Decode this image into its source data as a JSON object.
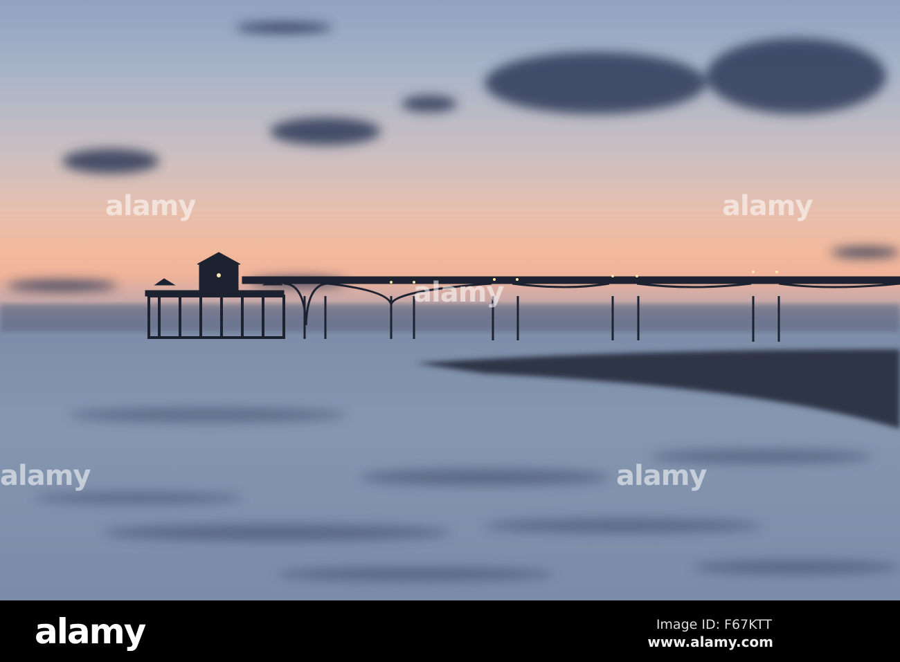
{
  "photo": {
    "subject": "pier at dusk"
  },
  "watermark": "alamy",
  "footer": {
    "logo": "alamy",
    "image_id": "Image ID: F67KTT",
    "url": "www.alamy.com"
  }
}
